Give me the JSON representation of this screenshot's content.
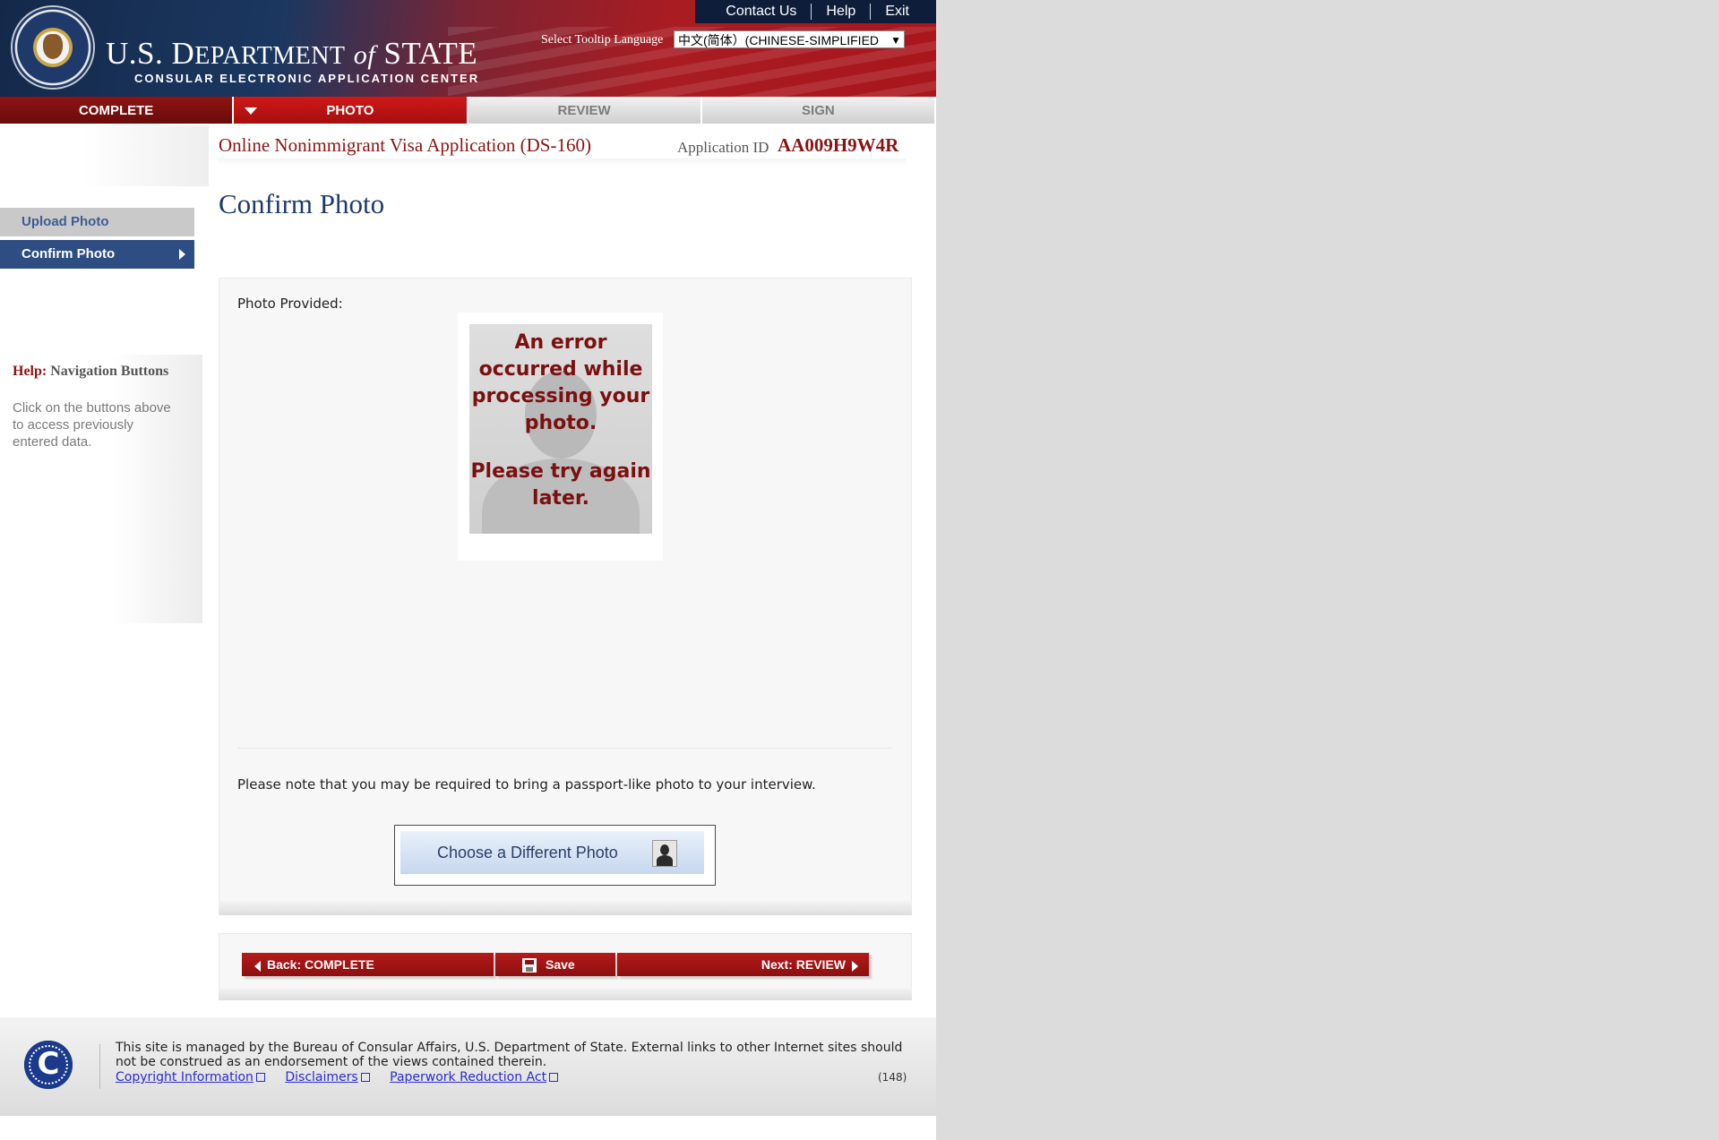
{
  "header": {
    "links": [
      "Contact Us",
      "Help",
      "Exit"
    ],
    "dept_name_1": "U.S. D",
    "dept_name_2": "EPARTMENT",
    "dept_of": "of",
    "dept_name_3": "STATE",
    "subtitle": "CONSULAR ELECTRONIC APPLICATION CENTER",
    "tooltip_label": "Select Tooltip Language",
    "tooltip_value": "中文(简体）(CHINESE-SIMPLIFIED"
  },
  "steps": [
    {
      "label": "COMPLETE",
      "state": "done"
    },
    {
      "label": "PHOTO",
      "state": "active"
    },
    {
      "label": "REVIEW",
      "state": "todo"
    },
    {
      "label": "SIGN",
      "state": "todo"
    }
  ],
  "sidebar": {
    "items": [
      "Upload Photo",
      "Confirm Photo"
    ],
    "help_prefix": "Help:",
    "help_title": "Navigation Buttons",
    "help_text": "Click on the buttons above to access previously entered data."
  },
  "main": {
    "app_title": "Online Nonimmigrant Visa Application (DS-160)",
    "app_id_label": "Application ID",
    "app_id": "AA009H9W4R",
    "page_title": "Confirm Photo",
    "photo_label": "Photo Provided:",
    "photo_error_1": "An error occurred while processing your photo.",
    "photo_error_2": "Please try again later.",
    "note": "Please note that you may be required to bring a passport-like photo to your interview.",
    "choose_button": "Choose a Different Photo"
  },
  "nav_buttons": {
    "back": "Back: COMPLETE",
    "save": "Save",
    "next": "Next: REVIEW"
  },
  "footer": {
    "text": "This site is managed by the Bureau of Consular Affairs, U.S. Department of State. External links to other Internet sites should not be construed as an endorsement of the views contained therein.",
    "links": [
      "Copyright Information",
      "Disclaimers",
      "Paperwork Reduction Act"
    ],
    "number": "(148)",
    "logo_letter": "C"
  },
  "colors": {
    "brand_red": "#a81c22",
    "brand_navy": "#1f3a6a",
    "active_nav": "#2e4d82"
  }
}
